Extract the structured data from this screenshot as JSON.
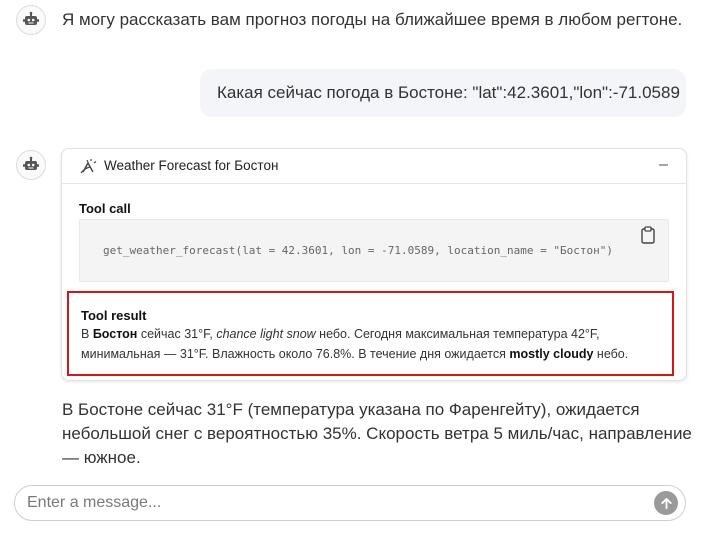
{
  "messages": {
    "assistant_intro": "Я могу рассказать вам прогноз погоды на ближайшее время в любом регтоне.",
    "user_question": "Какая сейчас погода в Бостоне: \"lat\":42.3601,\"lon\":-71.0589",
    "assistant_answer_line1": "В Бостоне сейчас 31°F (температура указана по Фаренгейту), ожидается",
    "assistant_answer_line2": "небольшой снег с вероятностью 35%. Скорость ветра 5 миль/час, направление",
    "assistant_answer_line3": "— южное."
  },
  "tool": {
    "title": "Weather Forecast for Бостон",
    "collapse_symbol": "–",
    "call_label": "Tool call",
    "call_code": "get_weather_forecast(lat = 42.3601, lon = -71.0589, location_name = \"Бостон\")",
    "result_label": "Tool result",
    "result": {
      "p1": "В ",
      "city": "Бостон",
      "p2": " сейчас 31°F, ",
      "condition_now": "chance light snow",
      "p3": " небо. Сегодня максимальная температура 42°F,",
      "p4": "минимальная — 31°F. Влажность около 76.8%. В течение дня ожидается ",
      "condition_day": "mostly cloudy",
      "p5": " небо."
    }
  },
  "composer": {
    "placeholder": "Enter a message..."
  },
  "icons": {
    "assistant_avatar": "robot-icon",
    "tool_icon": "weather-icon",
    "copy": "clipboard-icon",
    "send": "arrow-up-icon"
  }
}
